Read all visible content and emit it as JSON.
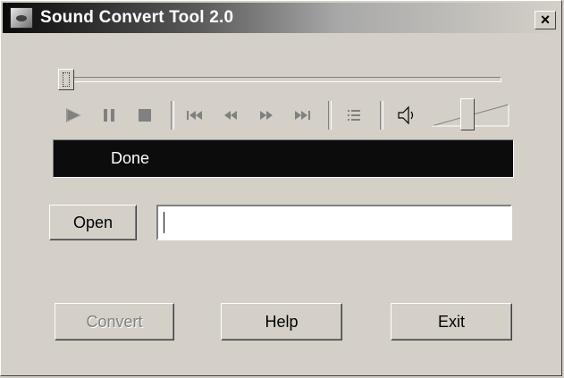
{
  "window": {
    "title": "Sound Convert Tool 2.0",
    "close_label": "×",
    "icon": "app-speaker-icon"
  },
  "player": {
    "seek_position": 0,
    "volume_level": 0.45,
    "controls": [
      {
        "name": "play-icon",
        "glyph": "▶"
      },
      {
        "name": "pause-icon",
        "glyph": "❚❚"
      },
      {
        "name": "stop-icon",
        "glyph": "■"
      },
      {
        "name": "skip-start-icon",
        "glyph": "|◀◀"
      },
      {
        "name": "rewind-icon",
        "glyph": "◀◀"
      },
      {
        "name": "fast-forward-icon",
        "glyph": "▶▶"
      },
      {
        "name": "skip-end-icon",
        "glyph": "▶▶|"
      },
      {
        "name": "playlist-icon",
        "glyph": "☷"
      },
      {
        "name": "speaker-icon",
        "glyph": "◀)"
      }
    ]
  },
  "status": {
    "text": "Done"
  },
  "file": {
    "open_label": "Open",
    "path_value": ""
  },
  "actions": {
    "convert_label": "Convert",
    "help_label": "Help",
    "exit_label": "Exit"
  }
}
